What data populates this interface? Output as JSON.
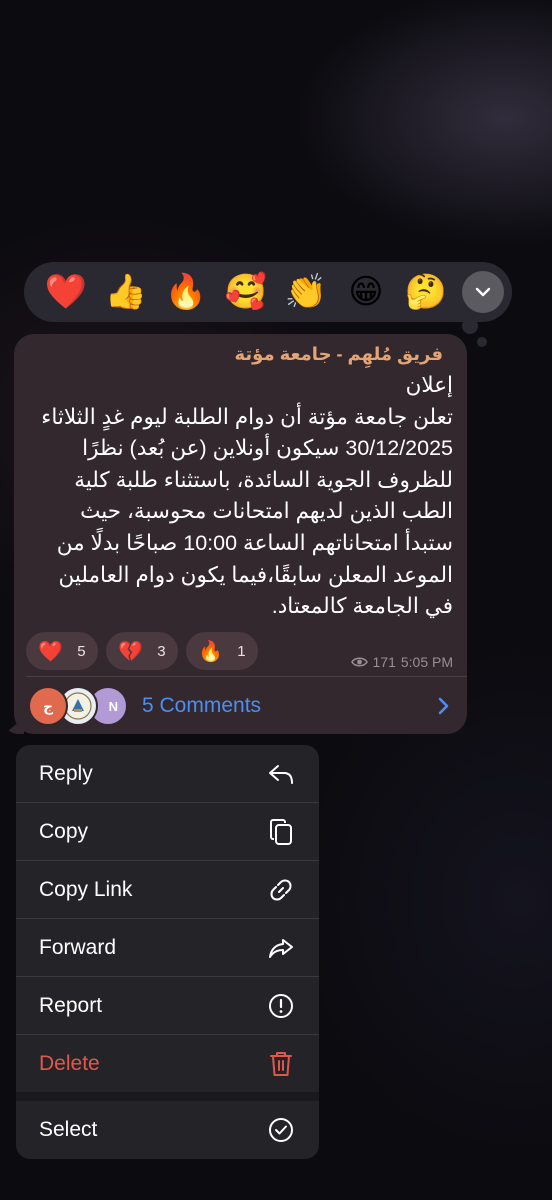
{
  "reaction_picker": {
    "emojis": [
      {
        "glyph": "❤️",
        "icon": "red-heart-icon"
      },
      {
        "glyph": "👍",
        "icon": "thumbs-up-icon"
      },
      {
        "glyph": "🔥",
        "icon": "fire-icon"
      },
      {
        "glyph": "🥰",
        "icon": "smiling-face-hearts-icon"
      },
      {
        "glyph": "👏",
        "icon": "clapping-hands-icon"
      },
      {
        "glyph": "😁",
        "icon": "grinning-face-icon"
      },
      {
        "glyph": "🤔",
        "icon": "thinking-face-icon"
      }
    ],
    "expand_icon": "chevron-down-icon"
  },
  "message": {
    "sender": "فريق مُلهِم - جامعة مؤتة",
    "text": "إعلان\nتعلن جامعة مؤتة أن دوام الطلبة ليوم غدٍ الثلاثاء 30/12/2025 سيكون أونلاين (عن بُعد) نظرًا للظروف الجوية السائدة، باستثناء طلبة كلية الطب الذين لديهم امتحانات محوسبة، حيث ستبدأ امتحاناتهم الساعة 10:00 صباحًا بدلًا من الموعد المعلن سابقًا،فيما يكون دوام العاملين في الجامعة كالمعتاد.",
    "reactions": [
      {
        "glyph": "❤️",
        "count": "5",
        "icon": "red-heart-icon"
      },
      {
        "glyph": "💔",
        "count": "3",
        "icon": "broken-heart-icon"
      },
      {
        "glyph": "🔥",
        "count": "1",
        "icon": "fire-icon"
      }
    ],
    "views": "171",
    "time": "5:05 PM",
    "comments": {
      "label": "5 Comments",
      "avatars": [
        {
          "initials": "ج",
          "color": "#e0694e"
        },
        {
          "initials": "",
          "color": "#e9eef2"
        },
        {
          "initials": "N",
          "color": "#b19ad6"
        }
      ]
    }
  },
  "context_menu": {
    "items": [
      {
        "label": "Reply",
        "icon": "reply-icon"
      },
      {
        "label": "Copy",
        "icon": "copy-icon"
      },
      {
        "label": "Copy Link",
        "icon": "link-icon"
      },
      {
        "label": "Forward",
        "icon": "forward-icon"
      },
      {
        "label": "Report",
        "icon": "report-icon"
      },
      {
        "label": "Delete",
        "icon": "trash-icon",
        "destructive": true
      }
    ],
    "secondary_items": [
      {
        "label": "Select",
        "icon": "checkmark-circle-icon"
      }
    ],
    "colors": {
      "destructive": "#e0584c",
      "link": "#4b8ef5"
    }
  }
}
